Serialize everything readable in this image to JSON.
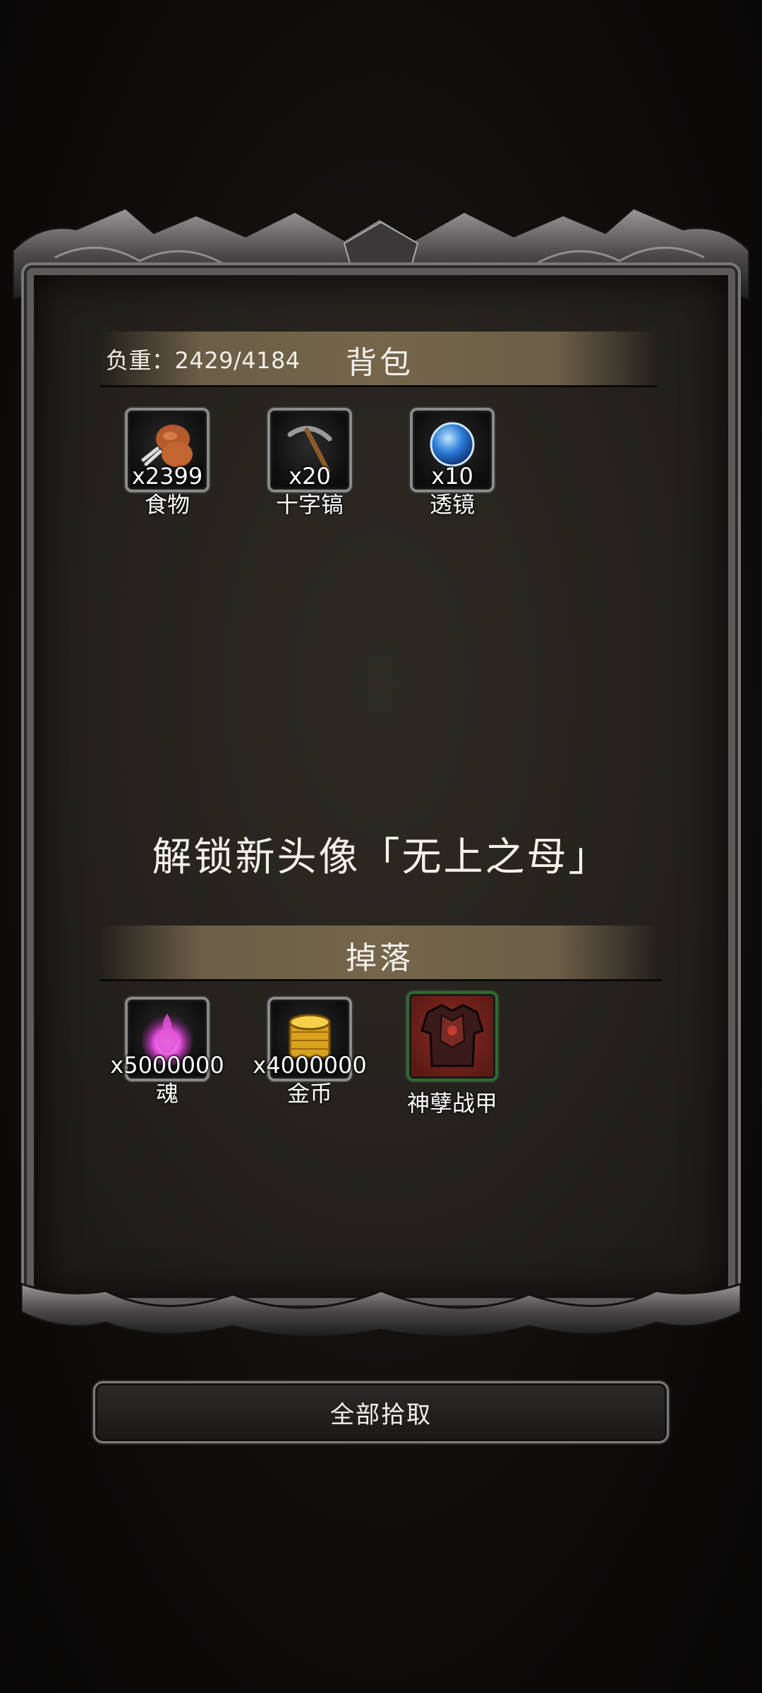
{
  "bag": {
    "weight_label": "负重：2429/4184",
    "title": "背包",
    "items": [
      {
        "name": "食物",
        "qty": "x2399",
        "icon": "roast-drumstick-icon"
      },
      {
        "name": "十字镐",
        "qty": "x20",
        "icon": "pickaxe-icon"
      },
      {
        "name": "透镜",
        "qty": "x10",
        "icon": "blue-lens-icon"
      }
    ]
  },
  "unlock_message": "解锁新头像「无上之母」",
  "drops": {
    "title": "掉落",
    "items": [
      {
        "name": "魂",
        "qty": "x5000000",
        "icon": "pink-soul-icon"
      },
      {
        "name": "金币",
        "qty": "x4000000",
        "icon": "gold-coins-icon"
      },
      {
        "name": "神孽战甲",
        "qty": "",
        "icon": "red-armor-icon"
      }
    ]
  },
  "actions": {
    "collect_all": "全部拾取"
  },
  "colors": {
    "panel_bg": "#2a2722",
    "band": "#7d6c50",
    "frame": "#5c5a5a",
    "text": "#f2efe8"
  }
}
